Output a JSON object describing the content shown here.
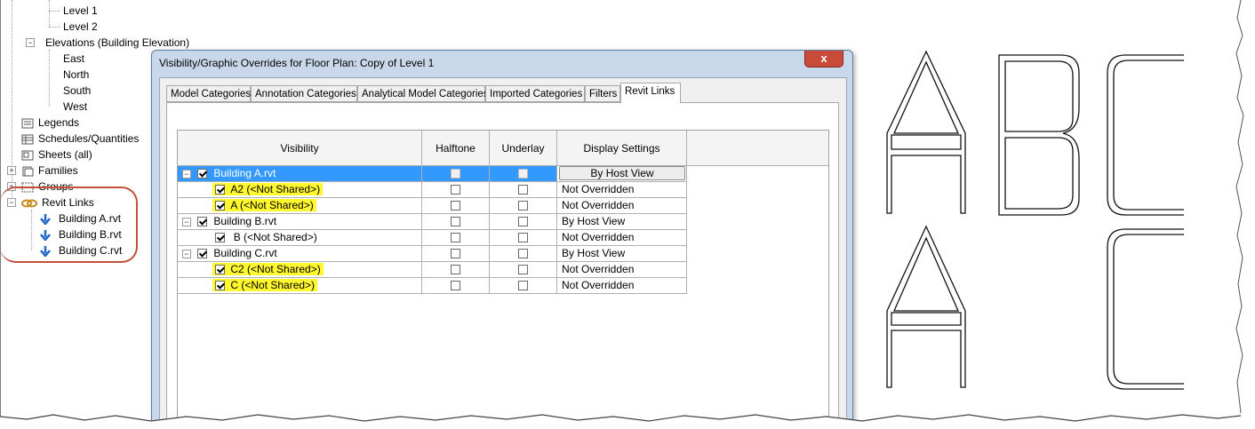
{
  "tree": {
    "items": [
      {
        "label": "Level 1",
        "icon": "none"
      },
      {
        "label": "Level 2",
        "icon": "none"
      },
      {
        "label": "Elevations (Building Elevation)",
        "icon": "collapse"
      },
      {
        "label": "East",
        "icon": "none"
      },
      {
        "label": "North",
        "icon": "none"
      },
      {
        "label": "South",
        "icon": "none"
      },
      {
        "label": "West",
        "icon": "none"
      },
      {
        "label": "Legends",
        "icon": "legend-icon"
      },
      {
        "label": "Schedules/Quantities",
        "icon": "schedule-icon"
      },
      {
        "label": "Sheets (all)",
        "icon": "sheet-icon"
      },
      {
        "label": "Families",
        "icon": "family-icon"
      },
      {
        "label": "Groups",
        "icon": "group-icon"
      },
      {
        "label": "Revit Links",
        "icon": "link-icon"
      },
      {
        "label": "Building A.rvt",
        "icon": "arrow-down-icon"
      },
      {
        "label": "Building B.rvt",
        "icon": "arrow-down-icon"
      },
      {
        "label": "Building C.rvt",
        "icon": "arrow-down-icon"
      }
    ]
  },
  "dialog": {
    "title": "Visibility/Graphic Overrides for Floor Plan: Copy of Level 1",
    "close_label": "x",
    "tabs": [
      "Model Categories",
      "Annotation Categories",
      "Analytical Model Categories",
      "Imported Categories",
      "Filters",
      "Revit Links"
    ],
    "active_tab": "Revit Links",
    "columns": [
      "Visibility",
      "Halftone",
      "Underlay",
      "Display Settings"
    ],
    "rows": [
      {
        "name": "Building A.rvt",
        "level": 0,
        "checked": true,
        "display": "By Host View",
        "selected": true,
        "highlight": false
      },
      {
        "name": "A2 (<Not Shared>)",
        "level": 1,
        "checked": true,
        "display": "Not Overridden",
        "selected": false,
        "highlight": true
      },
      {
        "name": "A (<Not Shared>)",
        "level": 1,
        "checked": true,
        "display": "Not Overridden",
        "selected": false,
        "highlight": true
      },
      {
        "name": "Building B.rvt",
        "level": 0,
        "checked": true,
        "display": "By Host View",
        "selected": false,
        "highlight": false
      },
      {
        "name": "B (<Not Shared>)",
        "level": 1,
        "checked": true,
        "display": "Not Overridden",
        "selected": false,
        "highlight": false
      },
      {
        "name": "Building C.rvt",
        "level": 0,
        "checked": true,
        "display": "By Host View",
        "selected": false,
        "highlight": false
      },
      {
        "name": "C2 (<Not Shared>)",
        "level": 1,
        "checked": true,
        "display": "Not Overridden",
        "selected": false,
        "highlight": true
      },
      {
        "name": "C (<Not Shared>)",
        "level": 1,
        "checked": true,
        "display": "Not Overridden",
        "selected": false,
        "highlight": true
      }
    ]
  },
  "colors": {
    "highlight": "#fff82e",
    "selection": "#3399ff",
    "annotation_circle": "#c0503a"
  }
}
